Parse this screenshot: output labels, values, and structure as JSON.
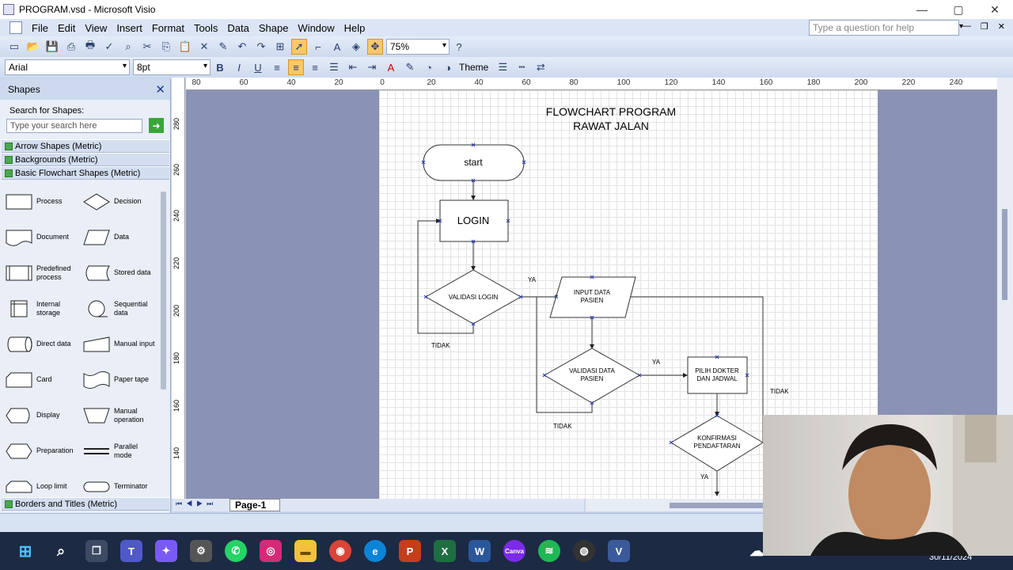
{
  "window": {
    "title": "PROGRAM.vsd - Microsoft Visio",
    "minimize": "—",
    "restore": "▢",
    "close": "✕"
  },
  "menu": [
    "File",
    "Edit",
    "View",
    "Insert",
    "Format",
    "Tools",
    "Data",
    "Shape",
    "Window",
    "Help"
  ],
  "help": {
    "placeholder": "Type a question for help"
  },
  "toolbar": {
    "zoom": "75%",
    "font": "Arial",
    "font_size": "8pt",
    "theme": "Theme"
  },
  "shapes_panel": {
    "title": "Shapes",
    "search_label": "Search for Shapes:",
    "search_placeholder": "Type your search here",
    "stencils": [
      "Arrow Shapes (Metric)",
      "Backgrounds (Metric)",
      "Basic Flowchart Shapes (Metric)"
    ],
    "items": [
      "Process",
      "Decision",
      "Document",
      "Data",
      "Predefined process",
      "Stored data",
      "Internal storage",
      "Sequential data",
      "Direct data",
      "Manual input",
      "Card",
      "Paper tape",
      "Display",
      "Manual operation",
      "Preparation",
      "Parallel mode",
      "Loop limit",
      "Terminator"
    ],
    "bottom_stencil": "Borders and Titles (Metric)"
  },
  "ruler": {
    "h_ticks": [
      "80",
      "60",
      "40",
      "20",
      "0",
      "20",
      "40",
      "60",
      "80",
      "100",
      "120",
      "140",
      "160",
      "180",
      "200",
      "220",
      "240"
    ],
    "v_ticks": [
      "280",
      "260",
      "240",
      "220",
      "200",
      "180",
      "160",
      "140"
    ]
  },
  "page_tab": "Page-1",
  "flowchart": {
    "title_line1": "FLOWCHART PROGRAM",
    "title_line2": "RAWAT JALAN",
    "start": "start",
    "login": "LOGIN",
    "validasi_login": "VALIDASI LOGIN",
    "input_data_line1": "INPUT DATA",
    "input_data_line2": "PASIEN",
    "validasi_data_line1": "VALIDASI DATA",
    "validasi_data_line2": "PASIEN",
    "pilih_dokter_line1": "PILIH DOKTER",
    "pilih_dokter_line2": "DAN JADWAL",
    "konfirmasi_line1": "KONFIRMASI",
    "konfirmasi_line2": "PENDAFTARAN",
    "ya1": "YA",
    "ya2": "YA",
    "ya3": "YA",
    "tidak1": "TIDAK",
    "tidak2": "TIDAK",
    "tidak3": "TIDAK"
  },
  "taskbar": {
    "clock_date": "30/11/2024"
  }
}
